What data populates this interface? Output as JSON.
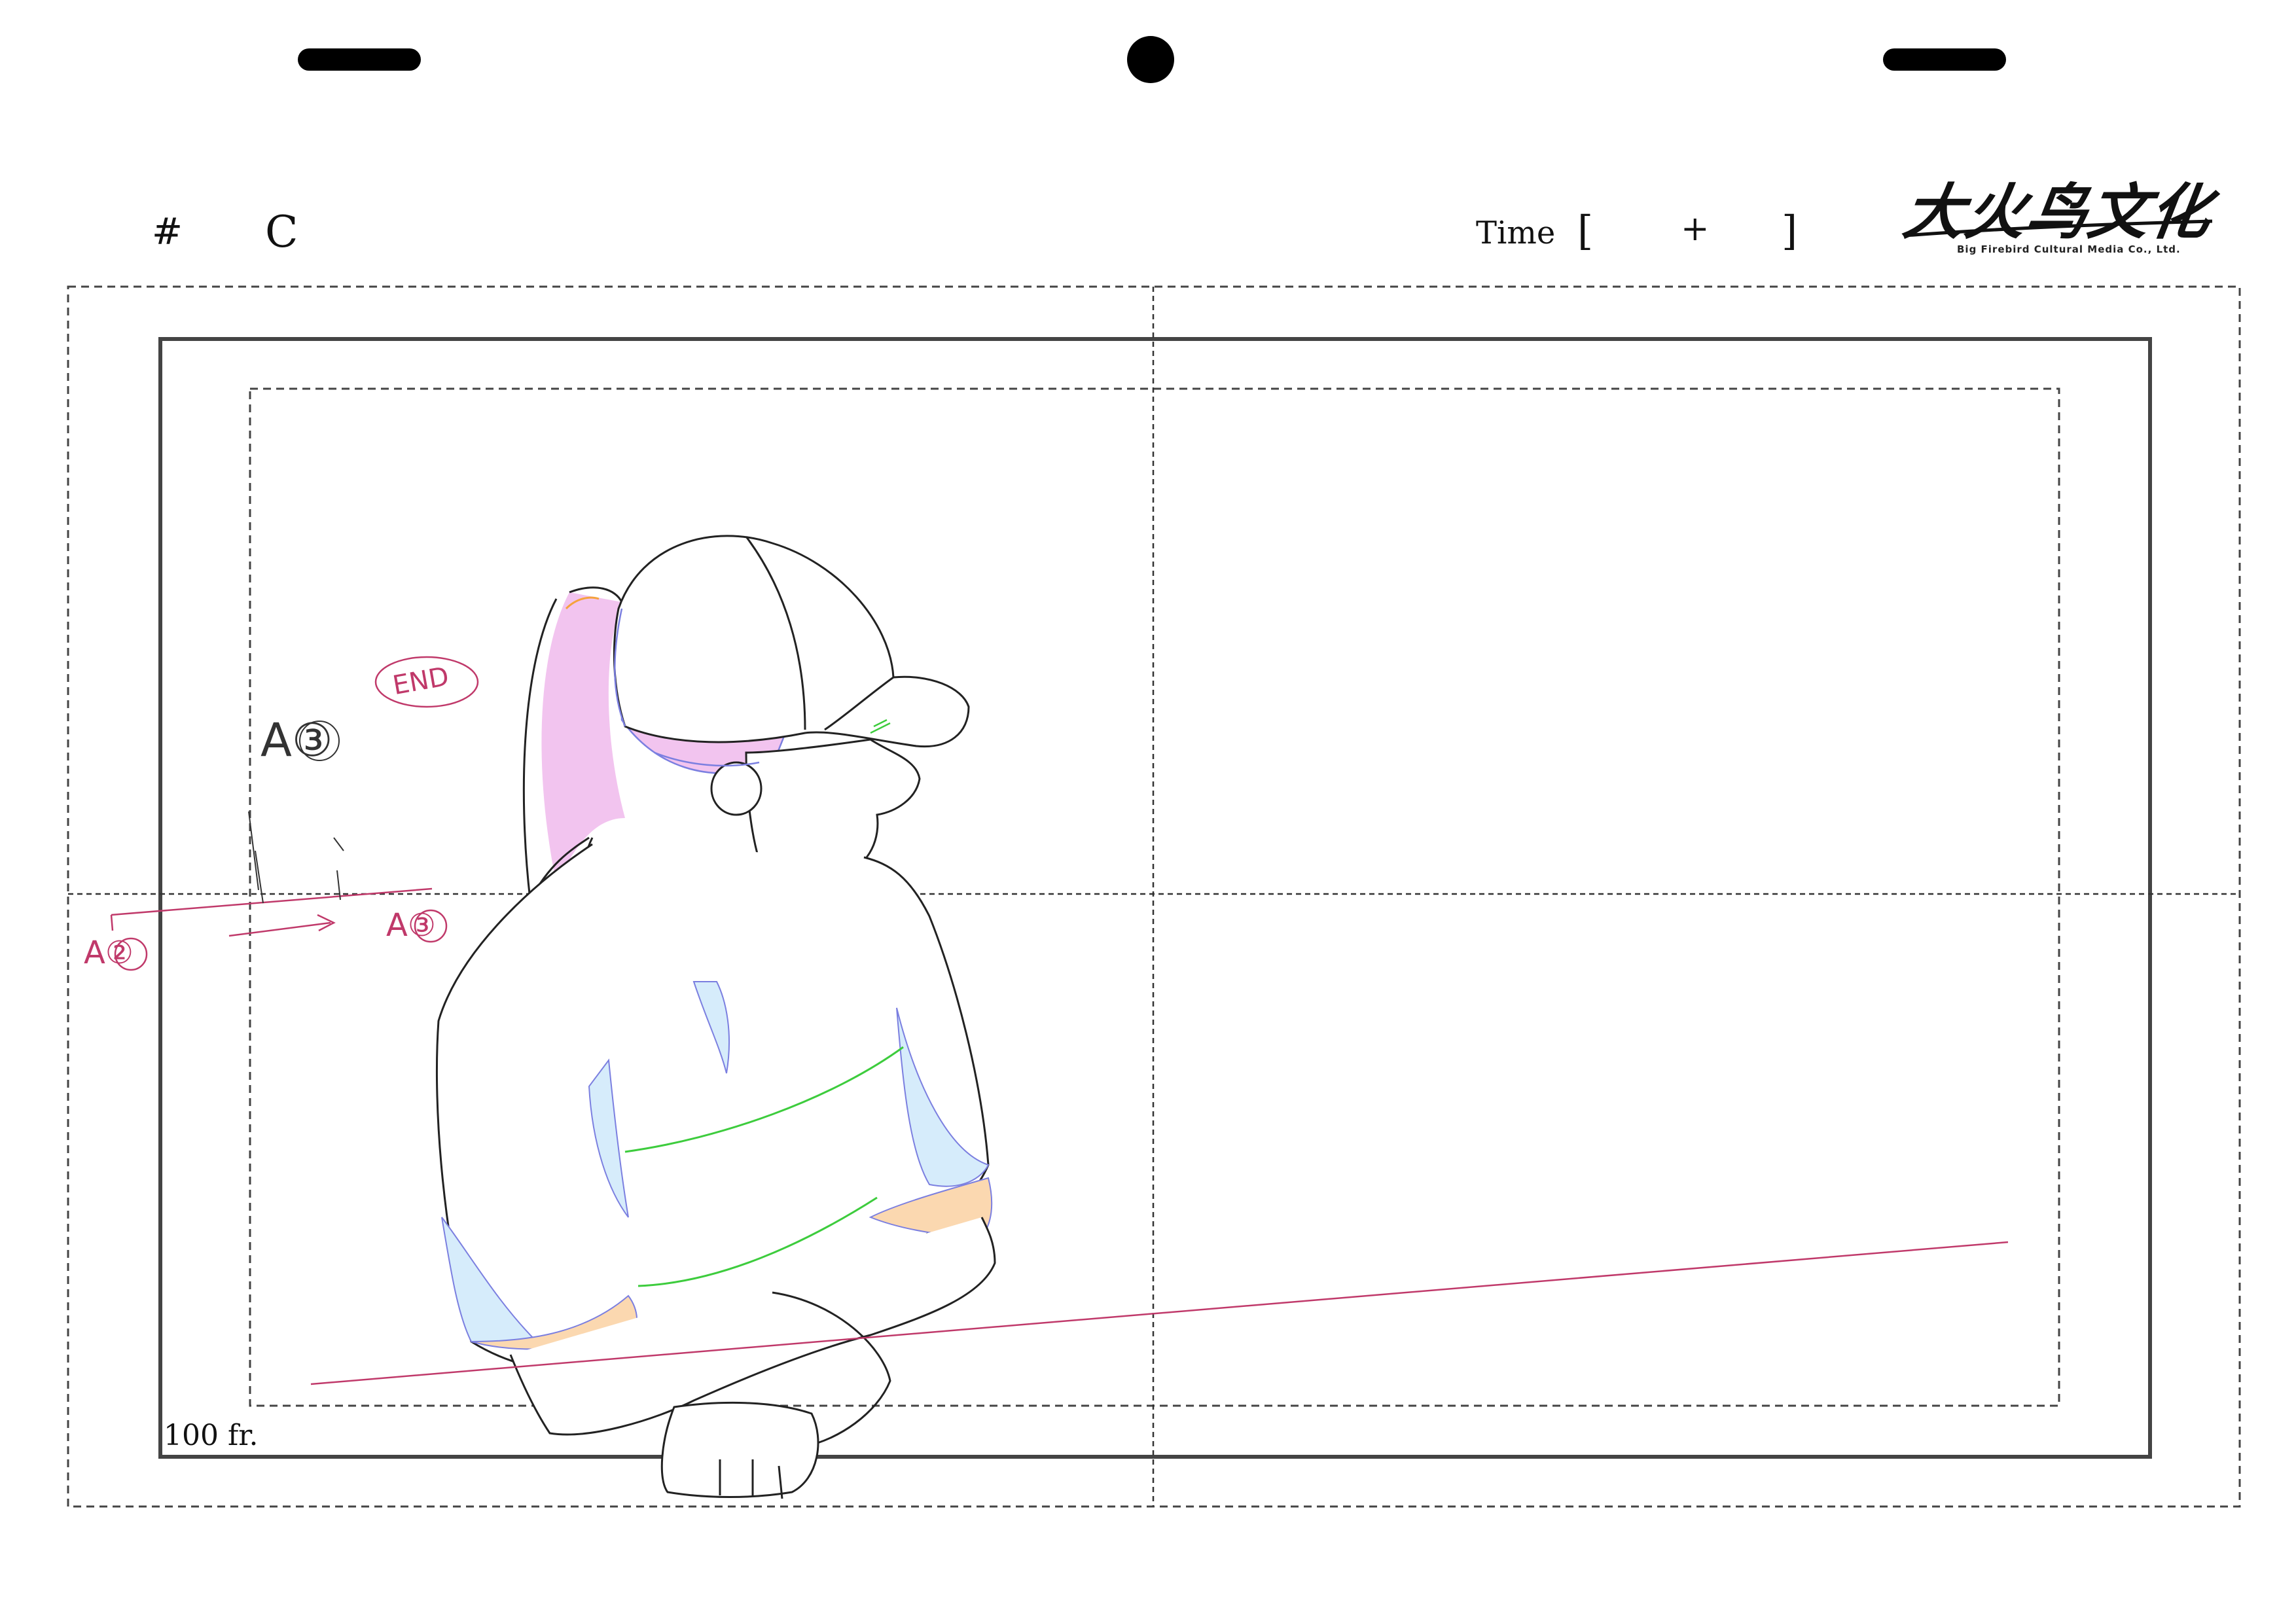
{
  "header": {
    "cut_symbol": "#",
    "cut_letter": "C",
    "time_label": "Time",
    "time_open_bracket": "[",
    "time_plus": "+",
    "time_close_bracket": "]"
  },
  "logo": {
    "main_text": "大火鸟文化",
    "sub_text": "Big Firebird Cultural Media Co., Ltd."
  },
  "frame_count_label": "100 fr.",
  "annotations": {
    "end_label": "END",
    "key_a3_top": "A③",
    "key_a2": "A②",
    "key_a3_bottom": "A③"
  },
  "colors": {
    "annotation_red": "#c0396a",
    "hair_pink": "#f2c4ef",
    "shadow_blue": "#d6ecfb",
    "skin_orange": "#fbd8b0",
    "line_green": "#3dcc3d",
    "line_blue": "#7b7fe0"
  }
}
